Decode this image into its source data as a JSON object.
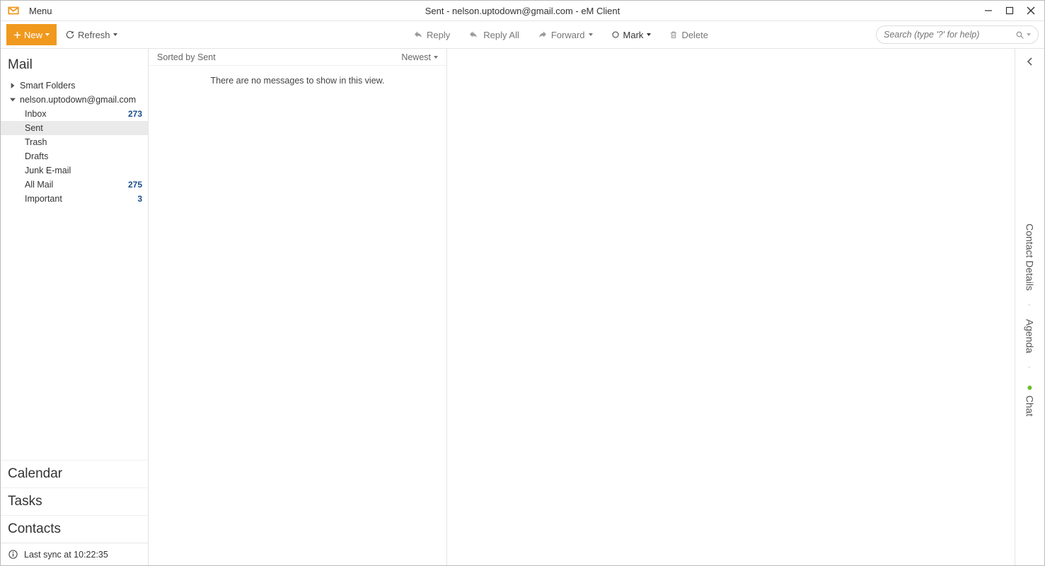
{
  "title": "Sent - nelson.uptodown@gmail.com - eM Client",
  "menu_label": "Menu",
  "toolbar": {
    "new_label": "New",
    "refresh_label": "Refresh",
    "reply_label": "Reply",
    "reply_all_label": "Reply All",
    "forward_label": "Forward",
    "mark_label": "Mark",
    "delete_label": "Delete",
    "search_placeholder": "Search (type '?' for help)"
  },
  "sidebar": {
    "section_mail": "Mail",
    "smart_folders_label": "Smart Folders",
    "account_label": "nelson.uptodown@gmail.com",
    "folders": [
      {
        "name": "Inbox",
        "count": "273",
        "selected": false
      },
      {
        "name": "Sent",
        "count": "",
        "selected": true
      },
      {
        "name": "Trash",
        "count": "",
        "selected": false
      },
      {
        "name": "Drafts",
        "count": "",
        "selected": false
      },
      {
        "name": "Junk E-mail",
        "count": "",
        "selected": false
      },
      {
        "name": "All Mail",
        "count": "275",
        "selected": false
      },
      {
        "name": "Important",
        "count": "3",
        "selected": false
      }
    ],
    "section_calendar": "Calendar",
    "section_tasks": "Tasks",
    "section_contacts": "Contacts"
  },
  "status": {
    "text": "Last sync at 10:22:35"
  },
  "list": {
    "sort_label": "Sorted by Sent",
    "order_label": "Newest",
    "empty_msg": "There are no messages to show in this view."
  },
  "rightbar": {
    "contact_details": "Contact Details",
    "agenda": "Agenda",
    "chat": "Chat"
  },
  "colors": {
    "accent": "#f0991d",
    "count": "#1a4f8b",
    "green": "#6dbf2b"
  }
}
